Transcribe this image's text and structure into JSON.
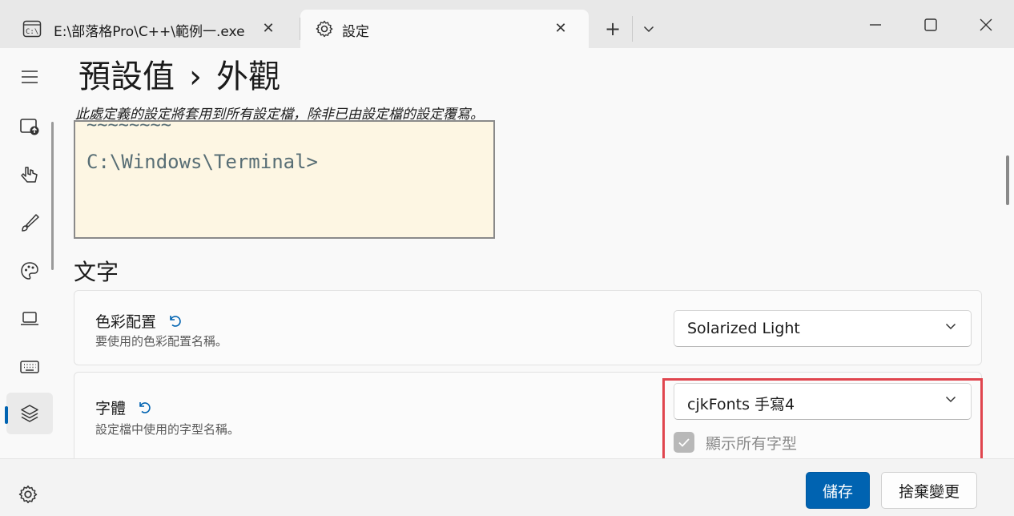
{
  "tabs": [
    {
      "label": "E:\\部落格Pro\\C++\\範例一.exe",
      "icon": "terminal-icon",
      "close": "✕"
    },
    {
      "label": "設定",
      "icon": "gear-icon",
      "close": "✕"
    }
  ],
  "titlebar": {
    "new_tab": "+",
    "dropdown_icon": "chevron-down-icon",
    "minimize_icon": "minimize-icon",
    "maximize_icon": "maximize-icon",
    "close_icon": "close-icon"
  },
  "nav": {
    "items": [
      "menu-icon",
      "startup-icon",
      "interaction-icon",
      "appearance-icon",
      "color-schemes-icon",
      "rendering-icon",
      "actions-icon",
      "defaults-icon"
    ],
    "selected": "defaults-icon",
    "settings_icon": "gear-icon"
  },
  "header": {
    "crumb1": "預設值",
    "separator": "›",
    "crumb2": "外觀",
    "description": "此處定義的設定將套用到所有設定檔，除非已由設定檔的設定覆寫。"
  },
  "preview": {
    "prompt": "C:\\Windows\\Terminal>",
    "background": "#fdf6e3"
  },
  "section": {
    "title": "文字"
  },
  "color_scheme": {
    "title": "色彩配置",
    "subtitle": "要使用的色彩配置名稱。",
    "value": "Solarized Light"
  },
  "font": {
    "title": "字體",
    "subtitle": "設定檔中使用的字型名稱。",
    "value": "cjkFonts 手寫4",
    "checkbox_label": "顯示所有字型",
    "checkbox_checked": true
  },
  "footer": {
    "save": "儲存",
    "discard": "捨棄變更"
  },
  "colors": {
    "accent": "#0063b1",
    "highlight": "#e0454e"
  }
}
